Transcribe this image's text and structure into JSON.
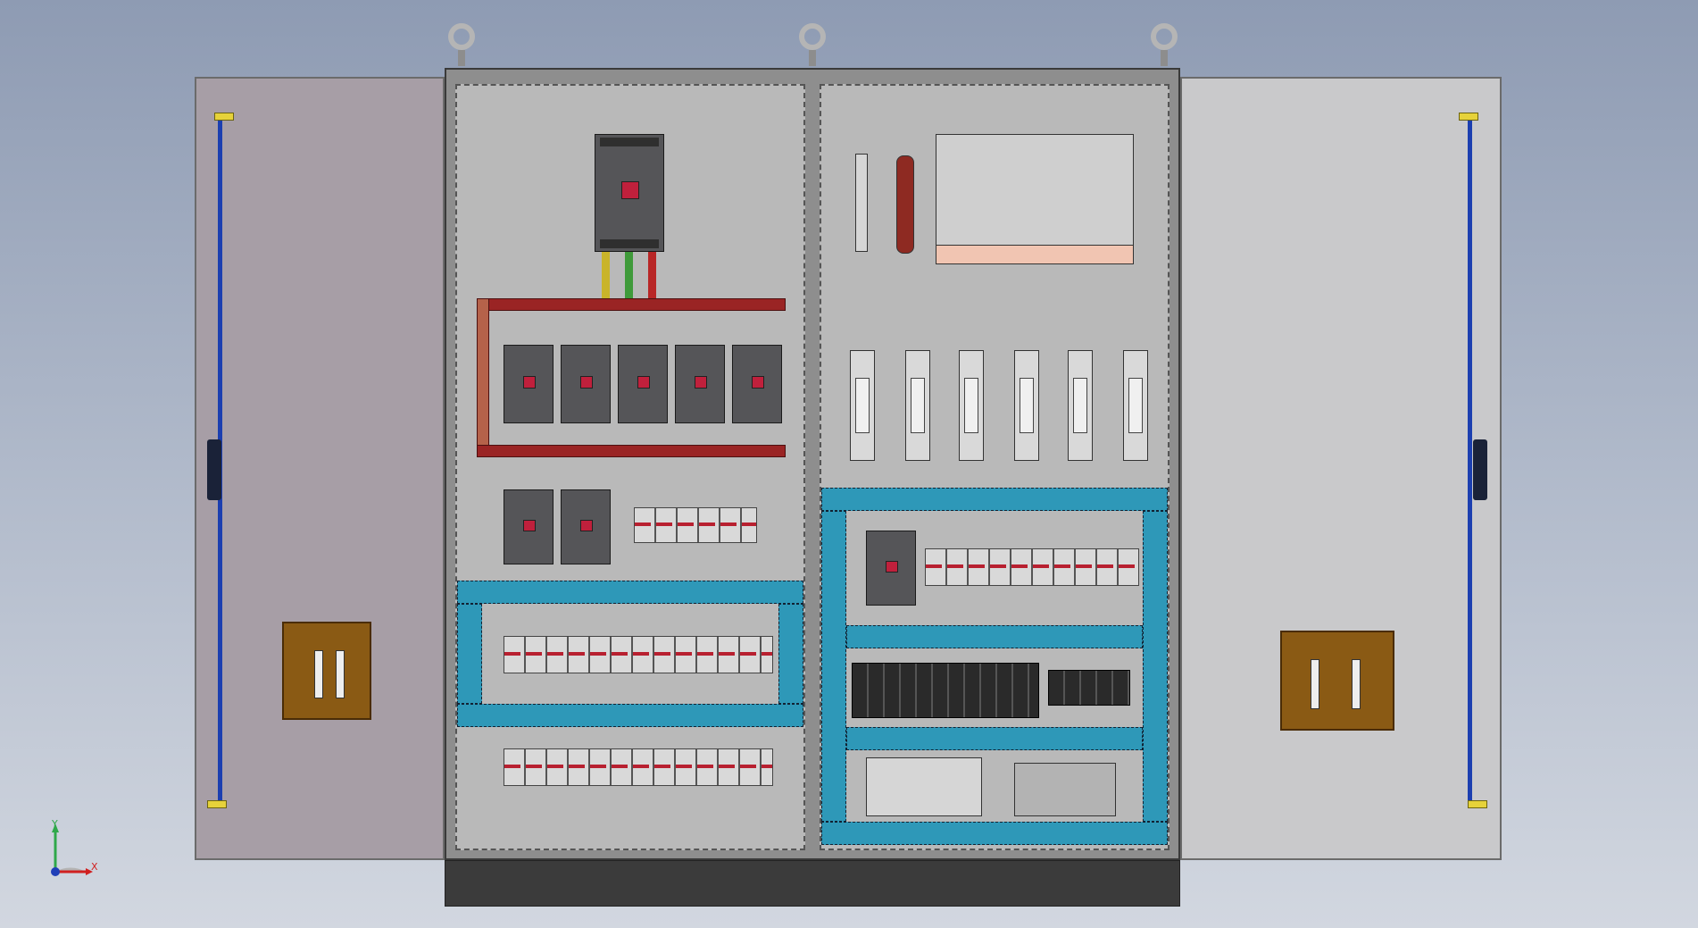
{
  "triad": {
    "x_label": "X",
    "y_label": "Y"
  },
  "colors": {
    "background_top": "#8e9bb3",
    "cabinet": "#8e8e8e",
    "mounting_plate": "#b9b9b9",
    "left_door": "#a79ea6",
    "right_door": "#c9c9cb",
    "busbar": "#9a2424",
    "wire_duct": "#2e98b8",
    "door_rod": "#1c3fb0",
    "door_handle": "#8a5a14",
    "breaker_body": "#555558"
  }
}
